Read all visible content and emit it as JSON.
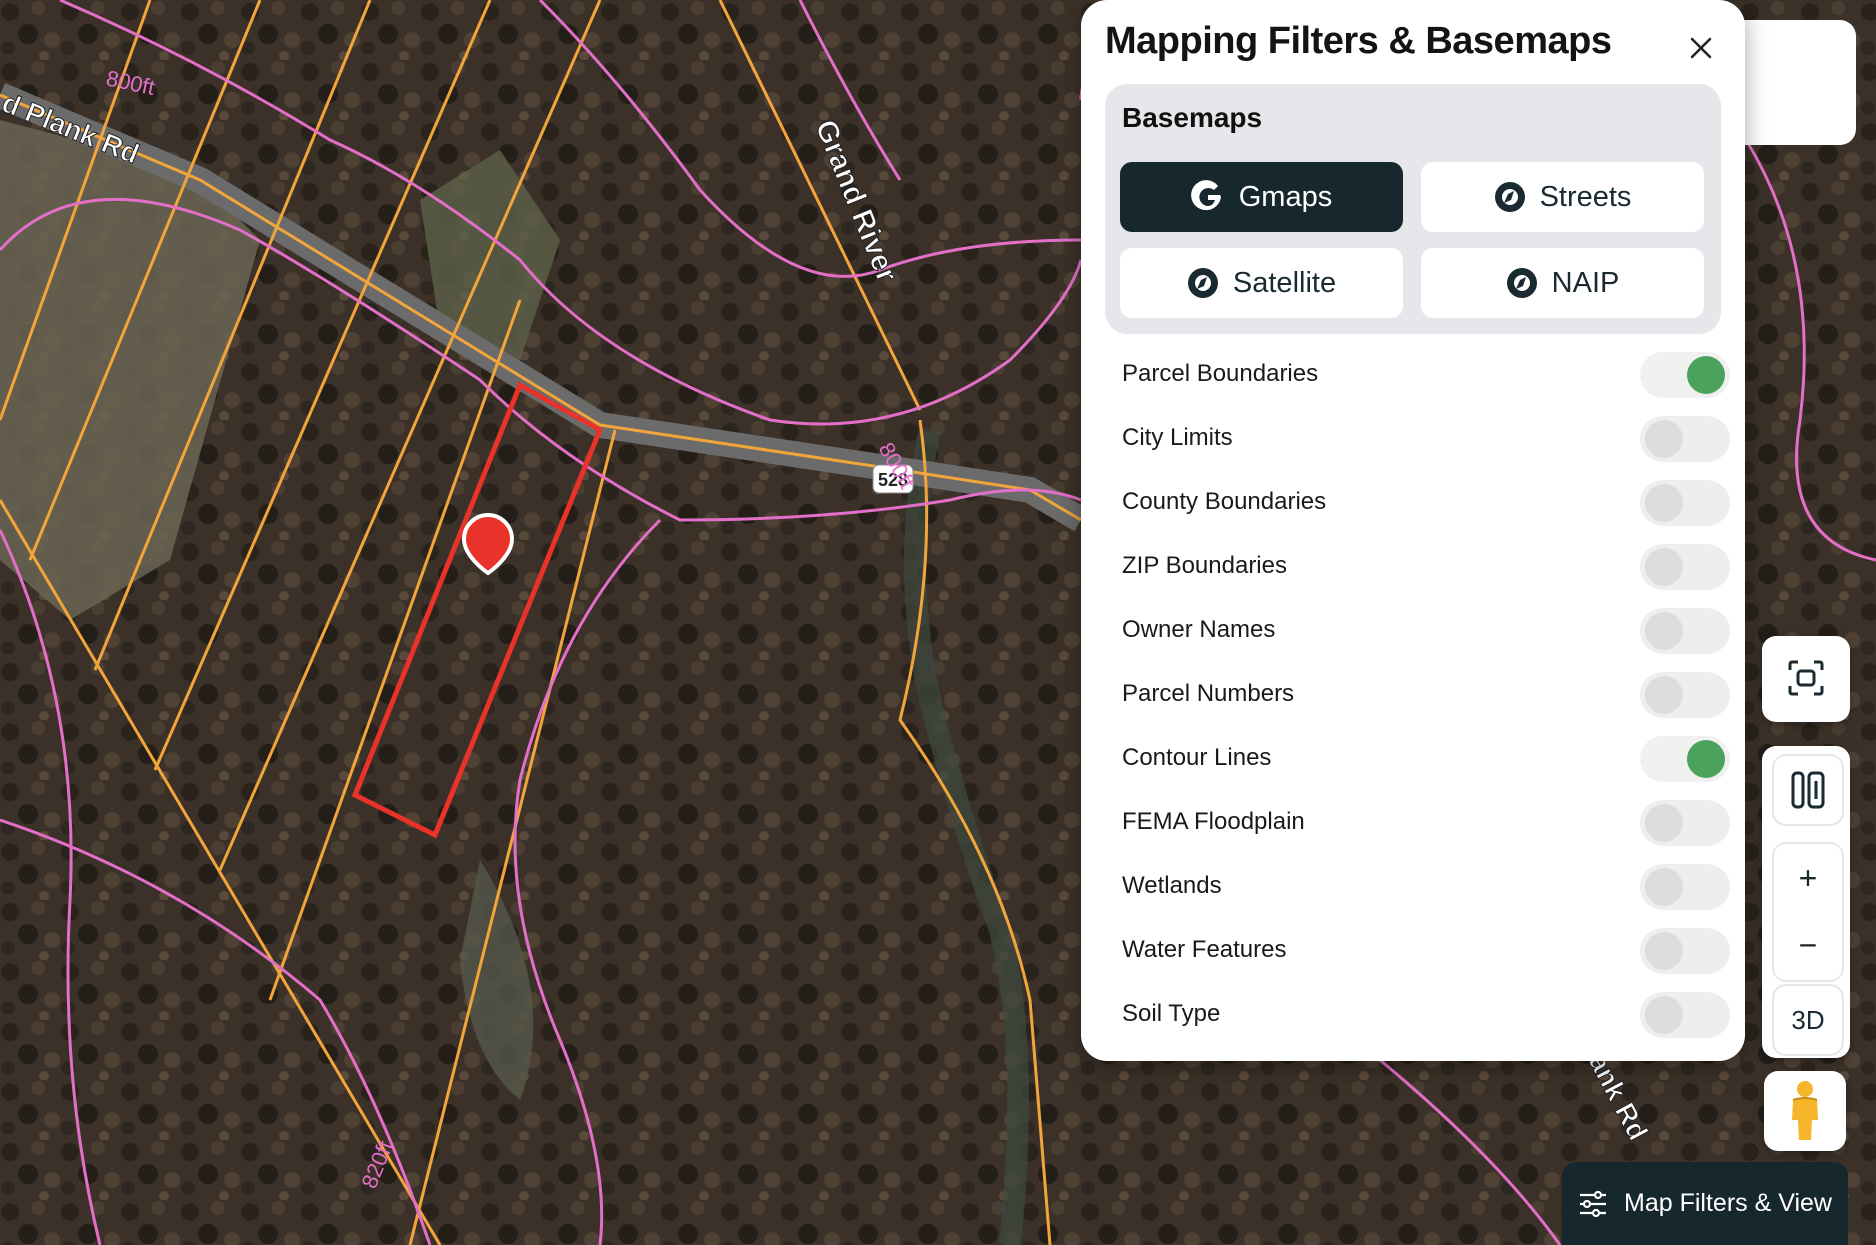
{
  "map": {
    "road_label_left": "d Plank Rd",
    "road_label_bottom": "ank Rd",
    "river_label": "Grand River",
    "route_shield": "528",
    "contour_labels": [
      "800ft",
      "820ft",
      "800ft"
    ],
    "marker": "location-pin-icon"
  },
  "panel": {
    "title": "Mapping Filters & Basemaps",
    "close_icon": "close-icon",
    "basemaps_title": "Basemaps",
    "basemaps": [
      {
        "label": "Gmaps",
        "icon": "google-g-icon",
        "active": true
      },
      {
        "label": "Streets",
        "icon": "compass-icon",
        "active": false
      },
      {
        "label": "Satellite",
        "icon": "compass-icon",
        "active": false
      },
      {
        "label": "NAIP",
        "icon": "compass-icon",
        "active": false
      }
    ],
    "layers": [
      {
        "label": "Parcel Boundaries",
        "on": true
      },
      {
        "label": "City Limits",
        "on": false
      },
      {
        "label": "County Boundaries",
        "on": false
      },
      {
        "label": "ZIP Boundaries",
        "on": false
      },
      {
        "label": "Owner Names",
        "on": false
      },
      {
        "label": "Parcel Numbers",
        "on": false
      },
      {
        "label": "Contour Lines",
        "on": true
      },
      {
        "label": "FEMA Floodplain",
        "on": false
      },
      {
        "label": "Wetlands",
        "on": false
      },
      {
        "label": "Water Features",
        "on": false
      },
      {
        "label": "Soil Type",
        "on": false
      }
    ]
  },
  "controls": {
    "fit_icon": "fit-screen-icon",
    "split_icon": "split-view-icon",
    "zoom_in": "+",
    "zoom_out": "−",
    "three_d": "3D",
    "pegman_icon": "street-view-pegman-icon"
  },
  "bottom_button": {
    "label": "Map Filters & View",
    "icon": "sliders-icon"
  },
  "colors": {
    "dark": "#16272d",
    "toggle_on": "#4aa25d",
    "parcel_line": "#f2a53a",
    "contour_line": "#e36fc9",
    "selected_parcel": "#e8322a",
    "arrow": "#e84a2e"
  }
}
